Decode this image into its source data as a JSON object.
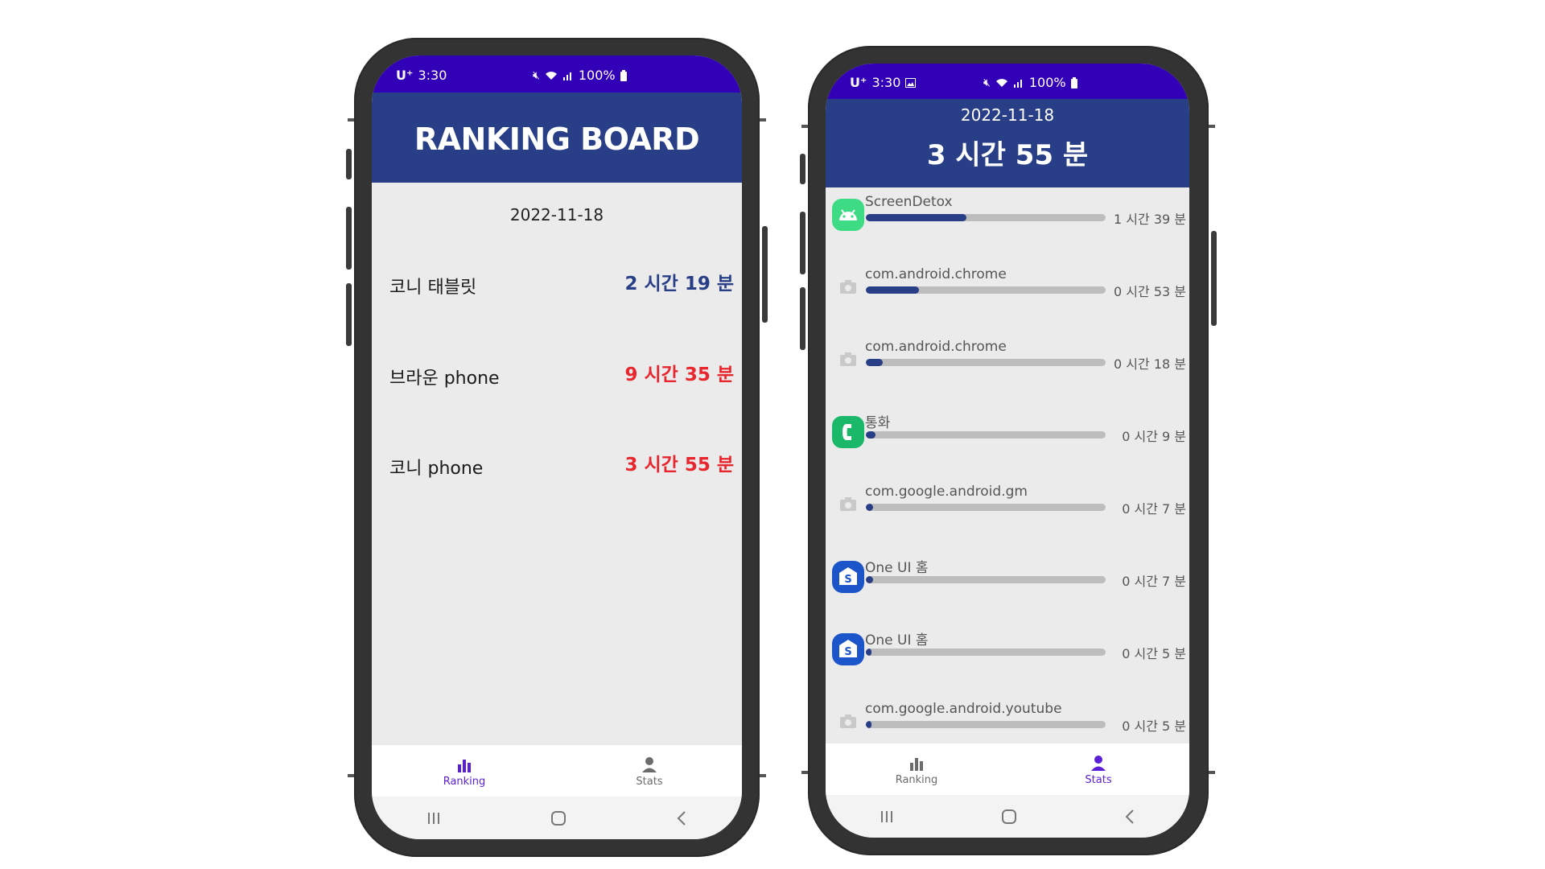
{
  "status_bar": {
    "carrier": "U⁺",
    "time": "3:30",
    "battery": "100%"
  },
  "ranking_screen": {
    "title": "RANKING BOARD",
    "date": "2022-11-18",
    "rows": [
      {
        "name": "코니 태블릿",
        "time": "2 시간 19 분"
      },
      {
        "name": "브라운 phone",
        "time": "9 시간 35 분"
      },
      {
        "name": "코니 phone",
        "time": "3 시간 55 분"
      }
    ],
    "nav": {
      "ranking": "Ranking",
      "stats": "Stats"
    }
  },
  "stats_screen": {
    "date": "2022-11-18",
    "total": "3 시간 55 분",
    "apps": [
      {
        "name": "ScreenDetox",
        "time": "1 시간 39 분",
        "share": 0.42,
        "icon": "android-icon"
      },
      {
        "name": "com.android.chrome",
        "time": "0 시간 53 분",
        "share": 0.22,
        "icon": "camera-placeholder-icon"
      },
      {
        "name": "com.android.chrome",
        "time": "0 시간 18 분",
        "share": 0.07,
        "icon": "camera-placeholder-icon"
      },
      {
        "name": "통화",
        "time": "0 시간 9 분",
        "share": 0.04,
        "icon": "phone-call-icon"
      },
      {
        "name": "com.google.android.gm",
        "time": "0 시간 7 분",
        "share": 0.03,
        "icon": "camera-placeholder-icon"
      },
      {
        "name": "One UI 홈",
        "time": "0 시간 7 분",
        "share": 0.03,
        "icon": "samsung-home-icon"
      },
      {
        "name": "One UI 홈",
        "time": "0 시간 5 분",
        "share": 0.02,
        "icon": "samsung-home-icon"
      },
      {
        "name": "com.google.android.youtube",
        "time": "0 시간 5 분",
        "share": 0.02,
        "icon": "camera-placeholder-icon"
      }
    ],
    "nav": {
      "ranking": "Ranking",
      "stats": "Stats"
    }
  },
  "colors": {
    "status_bar": "#3200b6",
    "header": "#283e86",
    "time_blue": "#283e86",
    "time_red": "#e8262d",
    "nav_active": "#5a1fd6",
    "bar_fill": "#283e86",
    "bar_track": "#bdbdbd"
  }
}
